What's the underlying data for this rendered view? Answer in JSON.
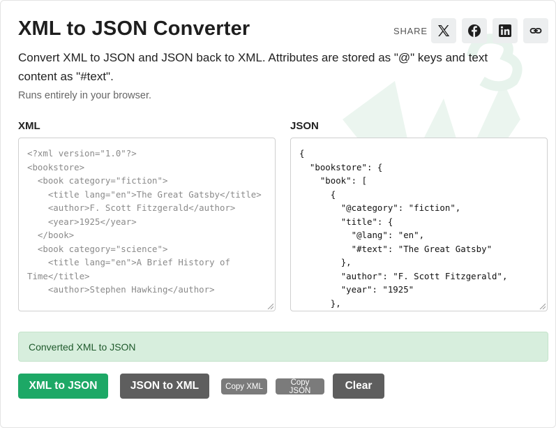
{
  "header": {
    "title": "XML to JSON Converter",
    "share_label": "SHARE",
    "share_icons": [
      "x-twitter-icon",
      "facebook-icon",
      "linkedin-icon",
      "link-icon"
    ]
  },
  "intro": {
    "description": "Convert XML to JSON and JSON back to XML. Attributes are stored as \"@\" keys and text content as \"#text\".",
    "note": "Runs entirely in your browser."
  },
  "xml_panel": {
    "label": "XML",
    "value": "<?xml version=\"1.0\"?>\n<bookstore>\n  <book category=\"fiction\">\n    <title lang=\"en\">The Great Gatsby</title>\n    <author>F. Scott Fitzgerald</author>\n    <year>1925</year>\n  </book>\n  <book category=\"science\">\n    <title lang=\"en\">A Brief History of Time</title>\n    <author>Stephen Hawking</author>"
  },
  "json_panel": {
    "label": "JSON",
    "value": "{\n  \"bookstore\": {\n    \"book\": [\n      {\n        \"@category\": \"fiction\",\n        \"title\": {\n          \"@lang\": \"en\",\n          \"#text\": \"The Great Gatsby\"\n        },\n        \"author\": \"F. Scott Fitzgerald\",\n        \"year\": \"1925\"\n      },"
  },
  "status": {
    "message": "Converted XML to JSON"
  },
  "actions": {
    "xml_to_json": "XML to JSON",
    "json_to_xml": "JSON to XML",
    "copy_xml": "Copy XML",
    "copy_json": "Copy JSON",
    "clear": "Clear"
  },
  "colors": {
    "primary_green": "#1da866",
    "dark_button": "#5e5e5e",
    "small_button": "#7b7b7b",
    "status_background": "#d7eedd",
    "status_text": "#1f5a2c"
  }
}
